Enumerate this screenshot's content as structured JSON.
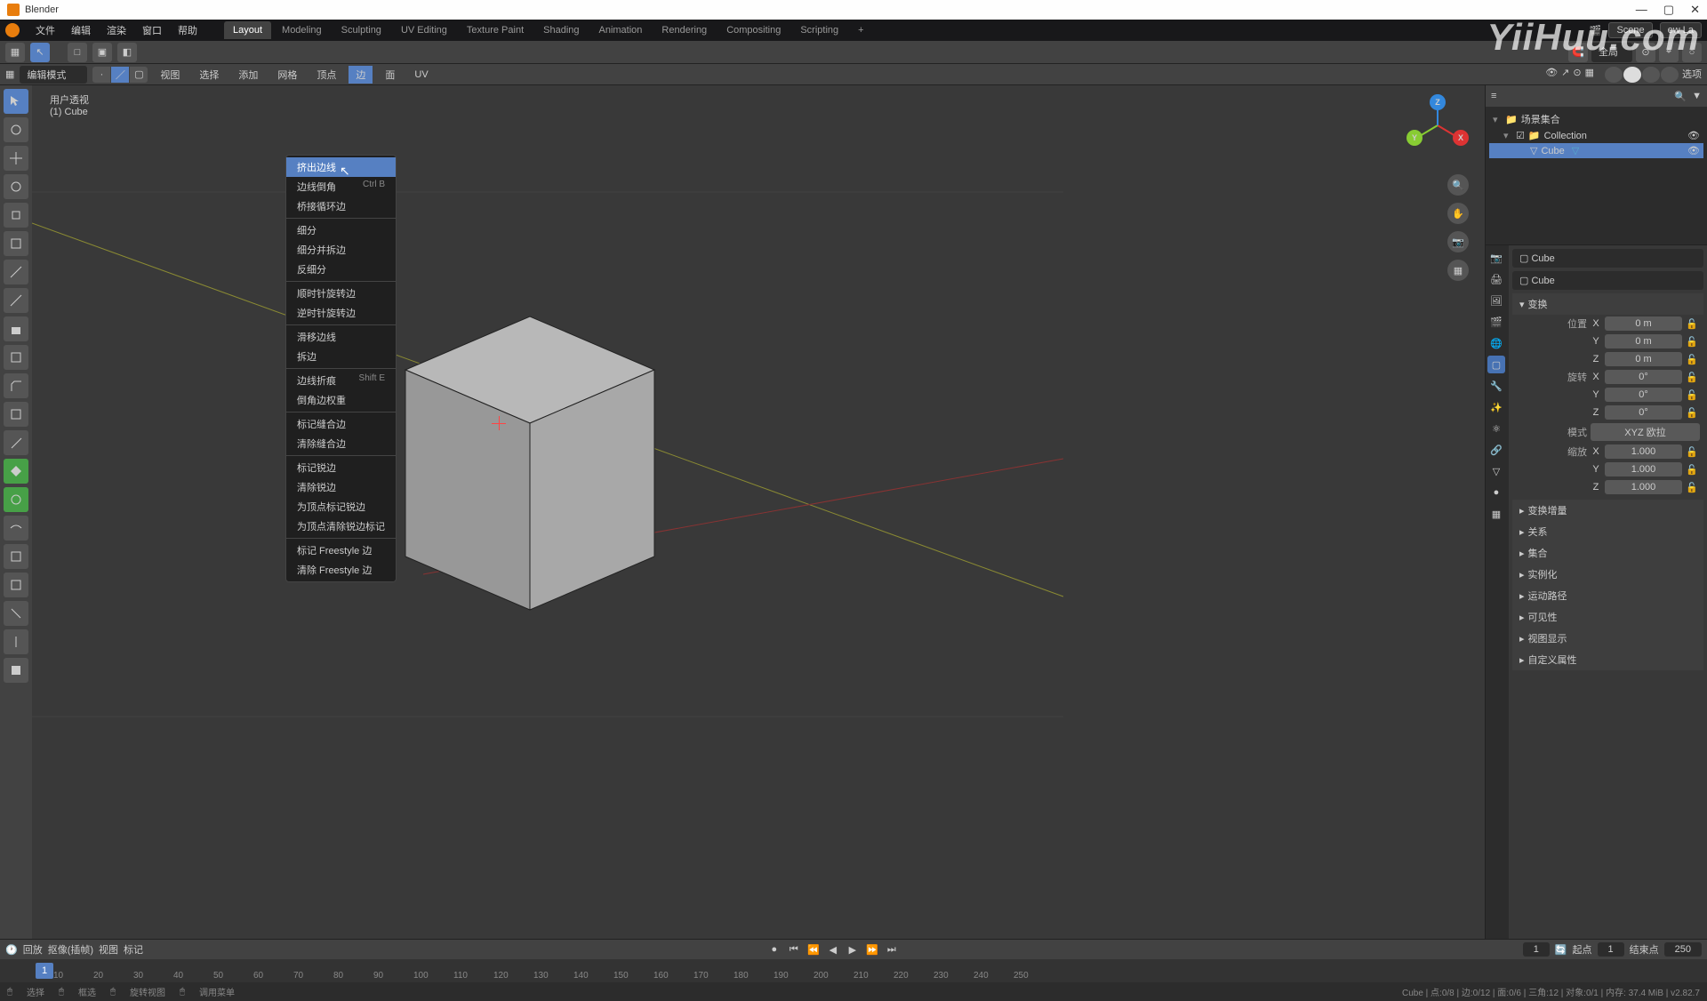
{
  "app": {
    "title": "Blender"
  },
  "watermark": "YiiHuu.com",
  "topmenu": {
    "items": [
      "文件",
      "编辑",
      "渲染",
      "窗口",
      "帮助"
    ],
    "tabs": [
      "Layout",
      "Modeling",
      "Sculpting",
      "UV Editing",
      "Texture Paint",
      "Shading",
      "Animation",
      "Rendering",
      "Compositing",
      "Scripting"
    ],
    "active_tab": 0,
    "scene_label": "Scene",
    "layer_label": "ew La"
  },
  "toolheader": {
    "snap_label": "全局"
  },
  "second_header": {
    "mode": "编辑模式",
    "menus": [
      "视图",
      "选择",
      "添加",
      "网格",
      "顶点",
      "边",
      "面",
      "UV"
    ],
    "active_menu_index": 5,
    "options_label": "选项"
  },
  "viewport": {
    "info_line1": "用户透视",
    "info_line2": "(1) Cube"
  },
  "context_menu": {
    "items": [
      {
        "label": "挤出边线",
        "shortcut": "",
        "highlighted": true
      },
      {
        "label": "边线倒角",
        "shortcut": "Ctrl B"
      },
      {
        "label": "桥接循环边",
        "shortcut": ""
      },
      {
        "type": "separator"
      },
      {
        "label": "细分",
        "shortcut": ""
      },
      {
        "label": "细分并拆边",
        "shortcut": ""
      },
      {
        "label": "反细分",
        "shortcut": ""
      },
      {
        "type": "separator"
      },
      {
        "label": "顺时针旋转边",
        "shortcut": ""
      },
      {
        "label": "逆时针旋转边",
        "shortcut": ""
      },
      {
        "type": "separator"
      },
      {
        "label": "滑移边线",
        "shortcut": ""
      },
      {
        "label": "拆边",
        "shortcut": ""
      },
      {
        "type": "separator"
      },
      {
        "label": "边线折痕",
        "shortcut": "Shift E"
      },
      {
        "label": "倒角边权重",
        "shortcut": ""
      },
      {
        "type": "separator"
      },
      {
        "label": "标记缝合边",
        "shortcut": ""
      },
      {
        "label": "清除缝合边",
        "shortcut": ""
      },
      {
        "type": "separator"
      },
      {
        "label": "标记锐边",
        "shortcut": ""
      },
      {
        "label": "清除锐边",
        "shortcut": ""
      },
      {
        "label": "为顶点标记锐边",
        "shortcut": ""
      },
      {
        "label": "为顶点清除锐边标记",
        "shortcut": ""
      },
      {
        "type": "separator"
      },
      {
        "label": "标记 Freestyle 边",
        "shortcut": ""
      },
      {
        "label": "清除 Freestyle 边",
        "shortcut": ""
      }
    ]
  },
  "gizmo": {
    "x": "X",
    "y": "Y",
    "z": "Z"
  },
  "outliner": {
    "header": "场景集合",
    "collection": "Collection",
    "item": "Cube"
  },
  "properties": {
    "breadcrumb": "Cube",
    "object_name": "Cube",
    "transform_header": "变换",
    "location_label": "位置",
    "rotation_label": "旋转",
    "mode_label": "模式",
    "mode_value": "XYZ 欧拉",
    "scale_label": "缩放",
    "location": {
      "x": "0 m",
      "y": "0 m",
      "z": "0 m"
    },
    "rotation": {
      "x": "0°",
      "y": "0°",
      "z": "0°"
    },
    "scale": {
      "x": "1.000",
      "y": "1.000",
      "z": "1.000"
    },
    "axes": {
      "x": "X",
      "y": "Y",
      "z": "Z"
    },
    "sections": [
      "变换增量",
      "关系",
      "集合",
      "实例化",
      "运动路径",
      "可见性",
      "视图显示",
      "自定义属性"
    ]
  },
  "timeline": {
    "playback": "回放",
    "keying": "抠像(插帧)",
    "view": "视图",
    "marker": "标记",
    "current_frame": "1",
    "start_label": "起点",
    "start_frame": "1",
    "end_label": "结束点",
    "end_frame": "250",
    "playhead": "1",
    "ticks": [
      "10",
      "20",
      "30",
      "40",
      "50",
      "60",
      "70",
      "80",
      "90",
      "100",
      "110",
      "120",
      "130",
      "140",
      "150",
      "160",
      "170",
      "180",
      "190",
      "200",
      "210",
      "220",
      "230",
      "240",
      "250"
    ]
  },
  "statusbar": {
    "select": "选择",
    "boxselect": "框选",
    "rotate": "旋转视图",
    "menu": "调用菜单",
    "stats": "Cube | 点:0/8 | 边:0/12 | 面:0/6 | 三角:12 | 对象:0/1 | 内存: 37.4 MiB | v2.82.7"
  }
}
